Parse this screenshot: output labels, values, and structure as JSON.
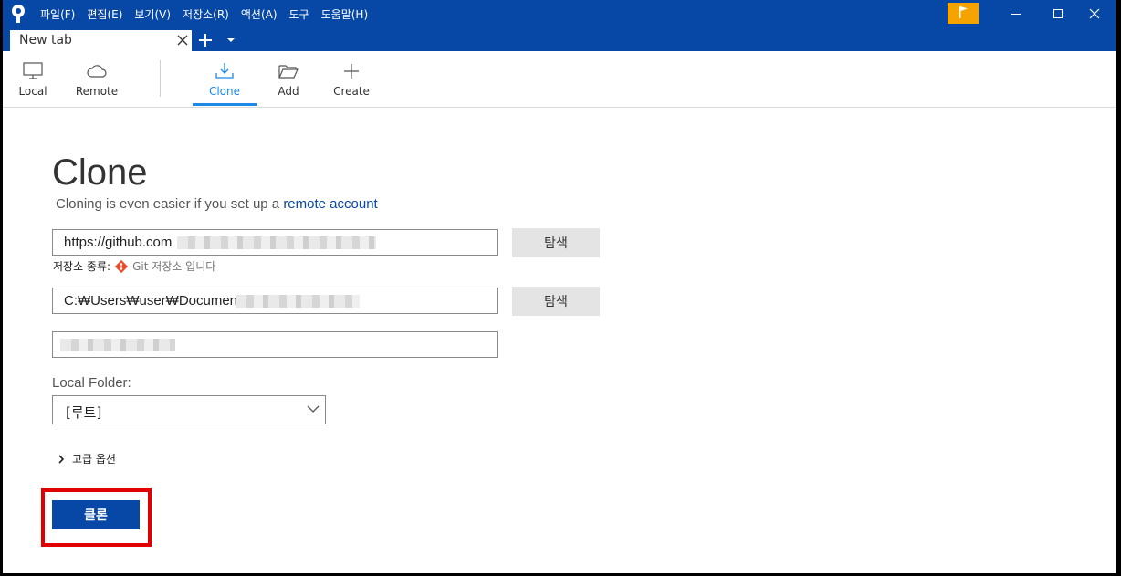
{
  "menu": [
    "파일(F)",
    "편집(E)",
    "보기(V)",
    "저장소(R)",
    "액션(A)",
    "도구",
    "도움말(H)"
  ],
  "tab": {
    "label": "New tab"
  },
  "toolbar": {
    "local": "Local",
    "remote": "Remote",
    "clone": "Clone",
    "add": "Add",
    "create": "Create"
  },
  "page": {
    "title": "Clone",
    "subtitle_prefix": "Cloning is even easier if you set up a ",
    "subtitle_link": "remote account"
  },
  "form": {
    "source_url": "https://github.com",
    "browse_label": "탐색",
    "repo_type_label": "저장소 종류:",
    "repo_type_value": "Git 저장소 입니다",
    "dest_path": "C:₩Users₩user₩Documents",
    "name_value": "",
    "local_folder_label": "Local Folder:",
    "local_folder_value": "[루트]",
    "advanced_label": "고급 옵션",
    "clone_button": "클론"
  },
  "colors": {
    "titlebar": "#0747a6",
    "accent": "#1e88e5",
    "flag": "#f5a300",
    "highlight": "#e00000"
  }
}
